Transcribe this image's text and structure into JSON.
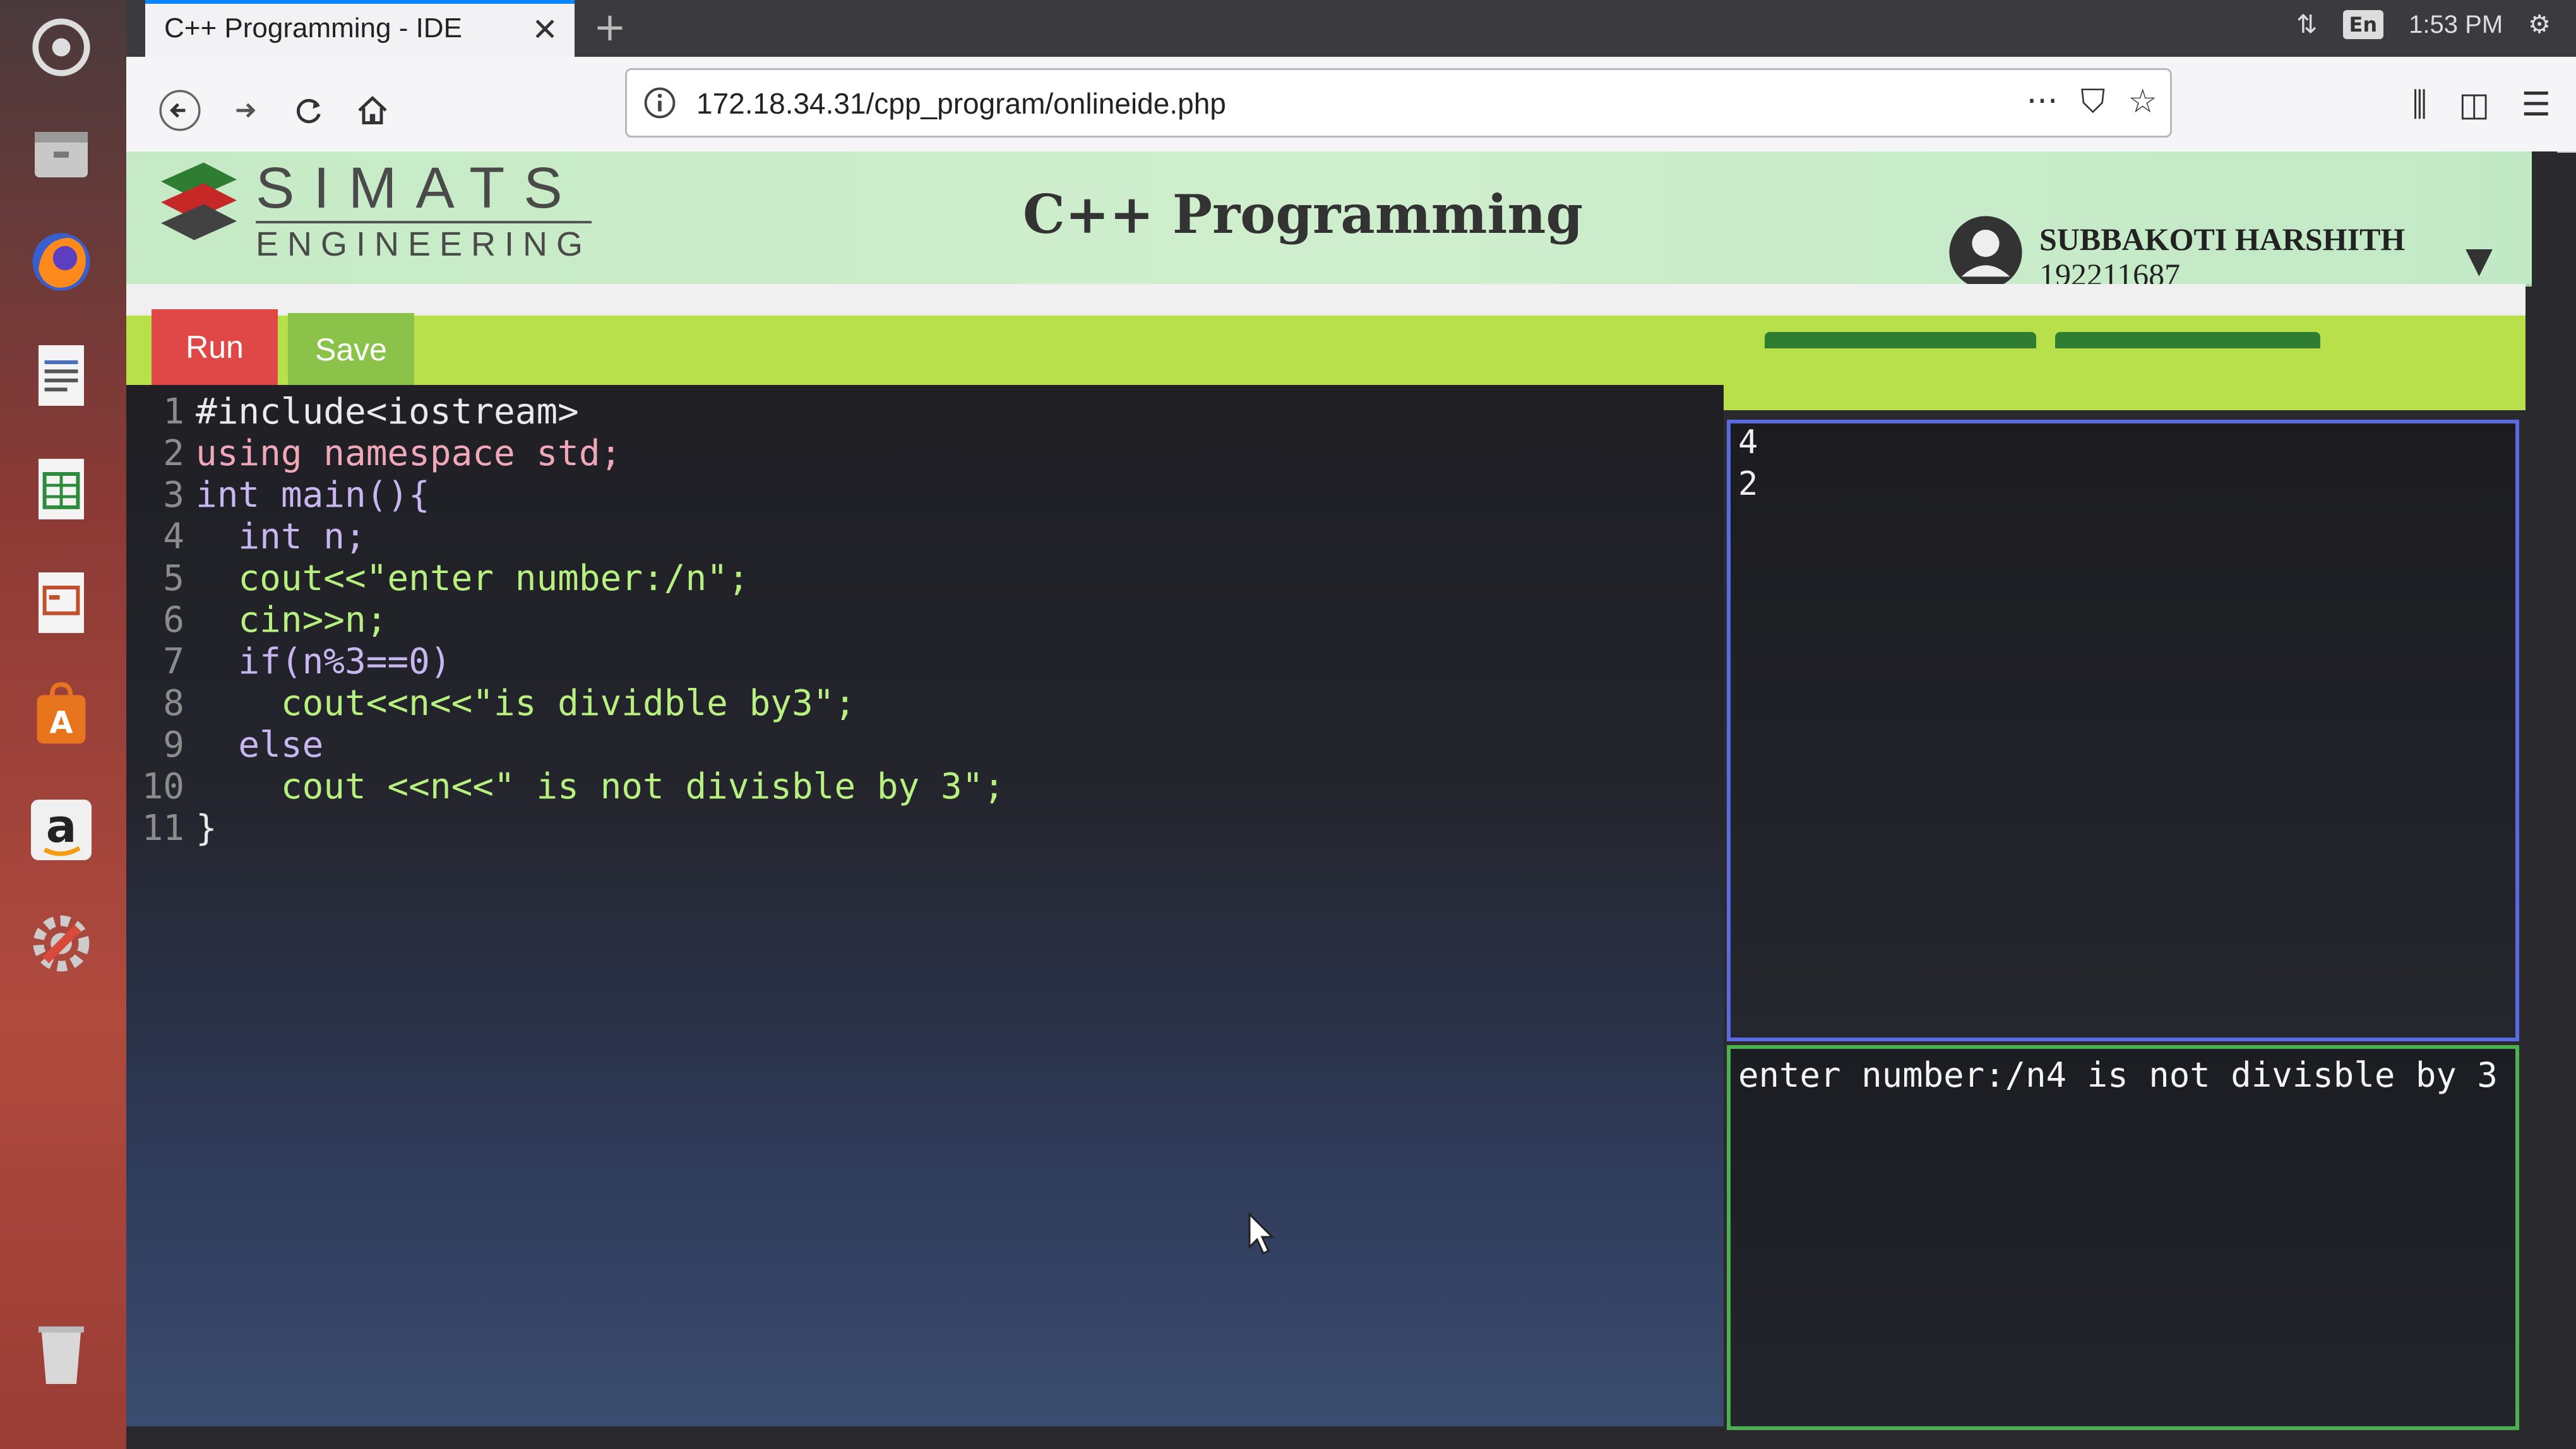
{
  "browser": {
    "tab_title": "C++ Programming - IDE",
    "tab_close": "✕",
    "new_tab": "+",
    "url": "172.18.34.31/cpp_program/onlineide.php",
    "more_icon": "···",
    "tray_lang": "En",
    "tray_time": "1:53 PM"
  },
  "header": {
    "brand_line1": "SIMATS",
    "brand_line2": "ENGINEERING",
    "title": "C++ Programming",
    "user_name": "SUBBAKOTI HARSHITH",
    "user_id": "192211687",
    "caret": "▼"
  },
  "toolbar": {
    "run_label": "Run",
    "save_label": "Save"
  },
  "editor": {
    "lines": [
      {
        "n": "1",
        "code": "#include<iostream>"
      },
      {
        "n": "2",
        "code": "using namespace std;"
      },
      {
        "n": "3",
        "code": "int main(){"
      },
      {
        "n": "4",
        "code": "  int n;"
      },
      {
        "n": "5",
        "code": "  cout<<\"enter number:/n\";"
      },
      {
        "n": "6",
        "code": "  cin>>n;"
      },
      {
        "n": "7",
        "code": "  if(n%3==0)"
      },
      {
        "n": "8",
        "code": "    cout<<n<<\"is dividble by3\";"
      },
      {
        "n": "9",
        "code": "  else"
      },
      {
        "n": "10",
        "code": "    cout <<n<<\" is not divisble by 3\";"
      },
      {
        "n": "11",
        "code": "}"
      }
    ]
  },
  "stdin": {
    "lines": [
      "4",
      "2"
    ]
  },
  "stdout": {
    "text": "enter number:/n4 is not divisble by 3"
  },
  "colors": {
    "run": "#e04848",
    "save": "#8bc34a",
    "toolbar": "#b8e04a",
    "header": "#c6eac6",
    "stdin_border": "#5a6ae0",
    "stdout_border": "#4caf50"
  }
}
